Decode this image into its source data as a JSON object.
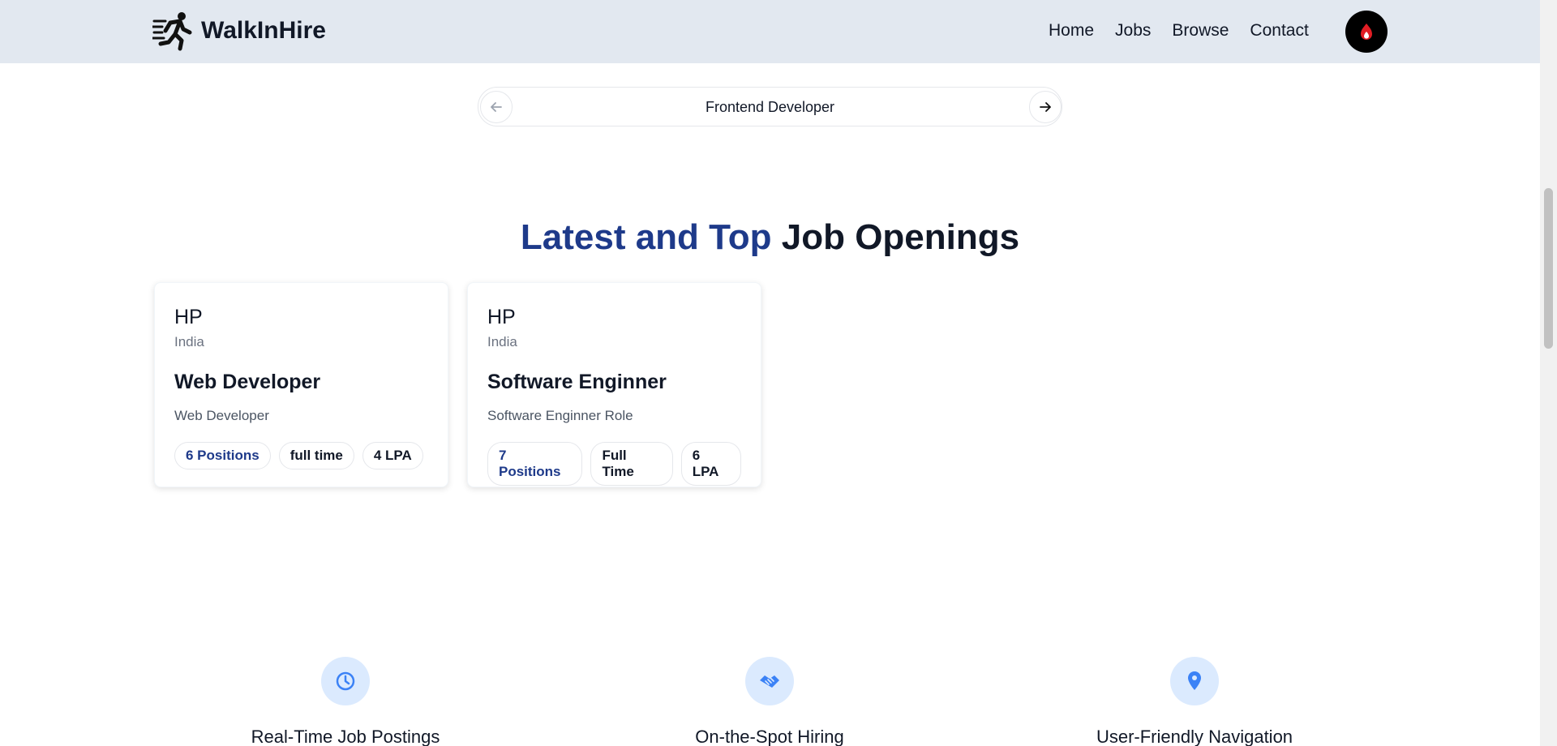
{
  "header": {
    "brand": "WalkInHire",
    "nav": [
      "Home",
      "Jobs",
      "Browse",
      "Contact"
    ]
  },
  "carousel": {
    "current": "Frontend Developer"
  },
  "section": {
    "title_accent": "Latest and Top",
    "title_rest": "Job Openings"
  },
  "jobs": [
    {
      "company": "HP",
      "location": "India",
      "title": "Web Developer",
      "description": "Web Developer",
      "positions": "6 Positions",
      "type": "full time",
      "salary": "4 LPA"
    },
    {
      "company": "HP",
      "location": "India",
      "title": "Software Enginner",
      "description": "Software Enginner Role",
      "positions": "7 Positions",
      "type": "Full Time",
      "salary": "6 LPA"
    }
  ],
  "features": [
    {
      "title": "Real-Time Job Postings",
      "icon": "clock-icon"
    },
    {
      "title": "On-the-Spot Hiring",
      "icon": "handshake-icon"
    },
    {
      "title": "User-Friendly Navigation",
      "icon": "location-pin-icon"
    }
  ],
  "colors": {
    "header_bg": "#e2e8f0",
    "accent": "#1e3a8a",
    "icon_blue": "#3b82f6",
    "icon_circle_bg": "#dbeafe"
  }
}
